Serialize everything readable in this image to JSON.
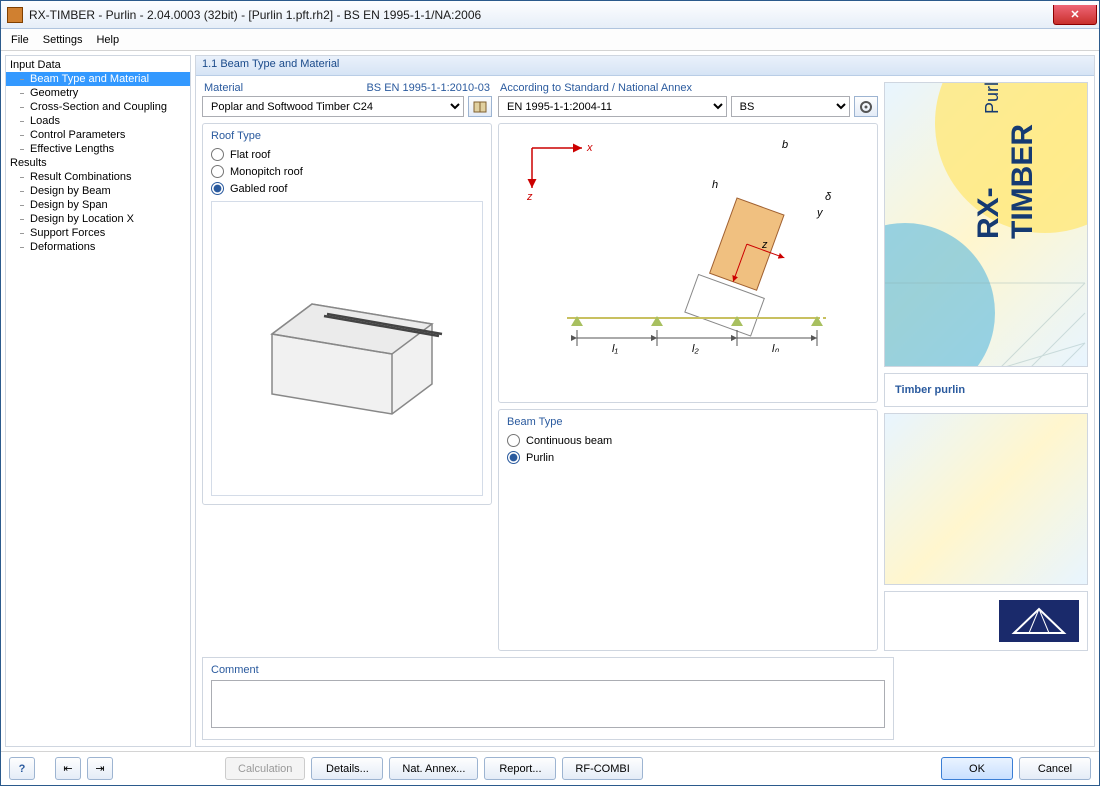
{
  "window": {
    "title": "RX-TIMBER - Purlin - 2.04.0003 (32bit) - [Purlin 1.pft.rh2] - BS EN 1995-1-1/NA:2006"
  },
  "menu": {
    "file": "File",
    "settings": "Settings",
    "help": "Help"
  },
  "nav": {
    "input": "Input Data",
    "items_input": [
      "Beam Type and Material",
      "Geometry",
      "Cross-Section and Coupling",
      "Loads",
      "Control Parameters",
      "Effective Lengths"
    ],
    "results": "Results",
    "items_results": [
      "Result Combinations",
      "Design by Beam",
      "Design by Span",
      "Design by Location X",
      "Support Forces",
      "Deformations"
    ]
  },
  "content": {
    "header": "1.1 Beam Type and Material",
    "material_label": "Material",
    "material_code": "BS EN 1995-1-1:2010-03",
    "material_value": "Poplar and Softwood Timber C24",
    "standard_label": "According to Standard / National Annex",
    "standard_value": "EN 1995-1-1:2004-11",
    "annex_value": "BS",
    "roof_type_label": "Roof Type",
    "roof_flat": "Flat roof",
    "roof_mono": "Monopitch roof",
    "roof_gabled": "Gabled roof",
    "beam_type_label": "Beam Type",
    "beam_continuous": "Continuous beam",
    "beam_purlin": "Purlin",
    "comment_label": "Comment",
    "diagram_labels": {
      "x": "x",
      "z": "z",
      "h": "h",
      "b": "b",
      "y": "y",
      "delta": "δ",
      "l1": "l₁",
      "l2": "l₂",
      "ln": "lₙ"
    }
  },
  "brand": {
    "product": "RX-TIMBER",
    "module": "Purlin",
    "caption": "Timber purlin"
  },
  "footer": {
    "calculation": "Calculation",
    "details": "Details...",
    "nat_annex": "Nat. Annex...",
    "report": "Report...",
    "rfcombi": "RF-COMBI",
    "ok": "OK",
    "cancel": "Cancel"
  }
}
